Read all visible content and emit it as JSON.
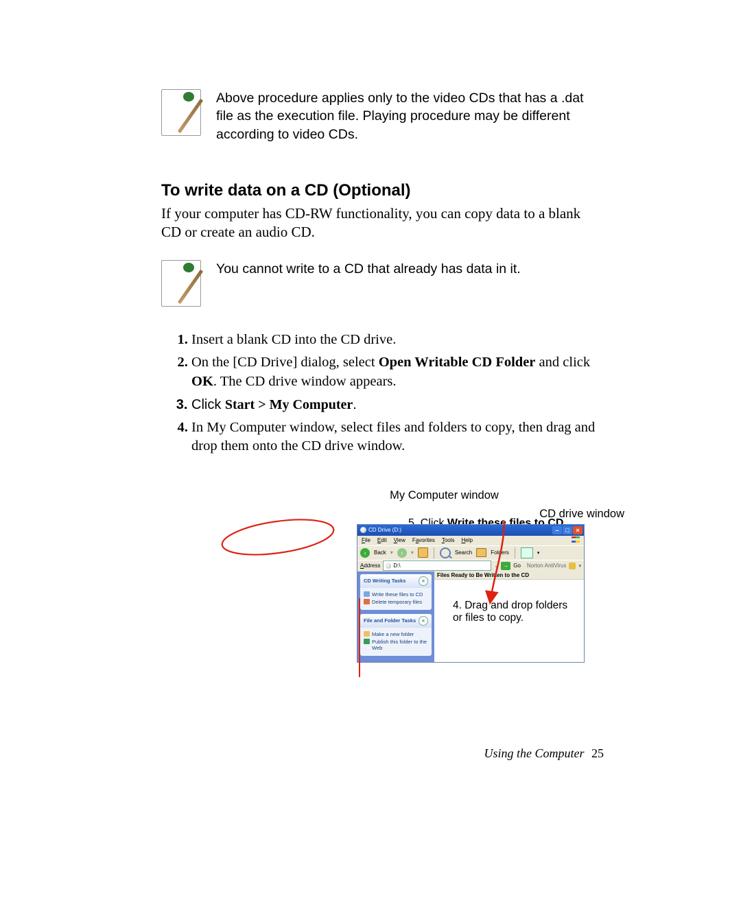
{
  "note1": "Above procedure applies only to the video CDs that has a .dat file as the execution file. Playing procedure may be different according to video CDs.",
  "heading": "To write data on a CD (Optional)",
  "intro": "If your computer has CD-RW functionality, you can copy data to a blank CD or create an audio CD.",
  "note2": "You cannot write to a CD that already has data in it.",
  "steps": {
    "s1": "Insert a blank CD into the CD drive.",
    "s2a": "On the [CD Drive] dialog, select ",
    "s2b": "Open Writable CD Folder",
    "s2c": " and click ",
    "s2d": "OK",
    "s2e": ". The CD drive window appears.",
    "s3a": "Click ",
    "s3b": "Start > My Computer",
    "s3c": ".",
    "s4": "In My Computer window, select files and folders to copy, then drag and drop them onto the CD drive window."
  },
  "captionMyComp": "My Computer window",
  "labelCdDrive": "CD drive window",
  "explorer": {
    "title": "CD Drive (D:)",
    "menus": {
      "file": "File",
      "edit": "Edit",
      "view": "View",
      "favorites": "Favorites",
      "tools": "Tools",
      "help": "Help"
    },
    "toolbar": {
      "back": "Back",
      "search": "Search",
      "folders": "Folders"
    },
    "address": {
      "label": "Address",
      "value": "D:\\",
      "go": "Go",
      "av": "Norton AntiVirus"
    },
    "contentHeader": "Files Ready to Be Written to the CD",
    "tasks": {
      "cdHead": "CD Writing Tasks",
      "write": "Write these files to CD",
      "delete": "Delete temporary files",
      "ffHead": "File and Folder Tasks",
      "newFolder": "Make a new folder",
      "publish": "Publish this folder to the Web"
    }
  },
  "callout": "4. Drag and drop folders or files to copy.",
  "captionBelow": {
    "a": "5. Click ",
    "b": "Write these files to CD",
    "c": "."
  },
  "footer": {
    "section": "Using the Computer",
    "page": "25"
  }
}
